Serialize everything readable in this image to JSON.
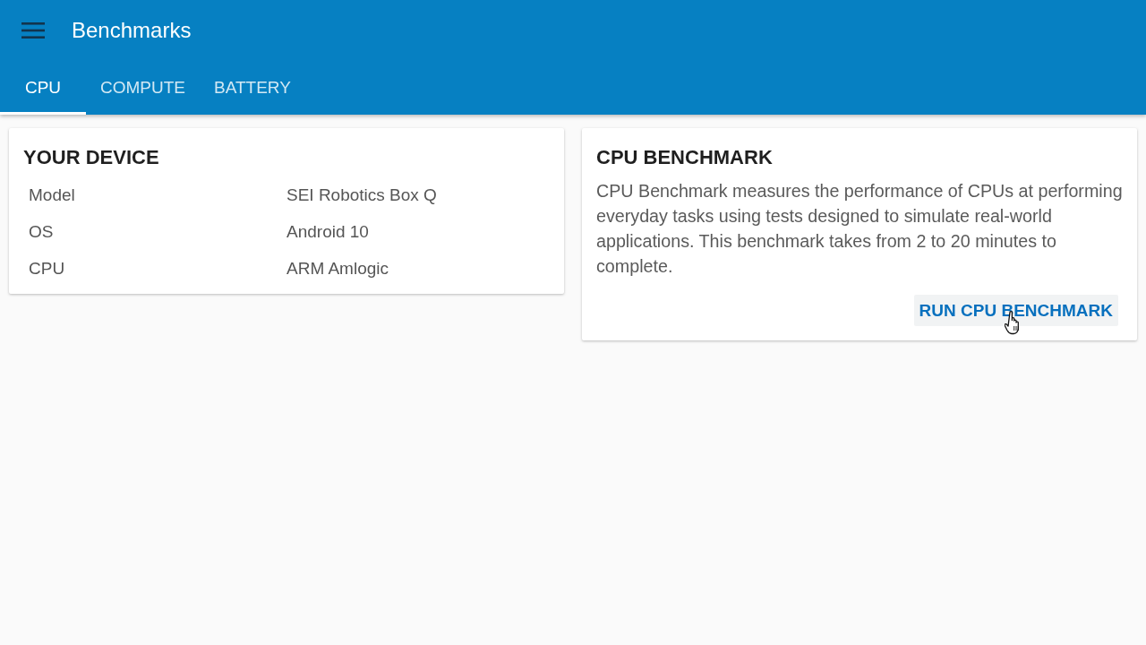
{
  "app_bar": {
    "title": "Benchmarks"
  },
  "tabs": [
    {
      "label": "CPU",
      "selected": true
    },
    {
      "label": "COMPUTE",
      "selected": false
    },
    {
      "label": "BATTERY",
      "selected": false
    }
  ],
  "device_card": {
    "title": "YOUR DEVICE",
    "rows": [
      {
        "label": "Model",
        "value": "SEI Robotics Box Q"
      },
      {
        "label": "OS",
        "value": "Android 10"
      },
      {
        "label": "CPU",
        "value": "ARM Amlogic"
      }
    ]
  },
  "benchmark_card": {
    "title": "CPU BENCHMARK",
    "description": "CPU Benchmark measures the performance of CPUs at performing everyday tasks using tests designed to simulate real-world applications. This benchmark takes from 2 to 20 minutes to complete.",
    "button": {
      "label": "RUN CPU BENCHMARK",
      "focused": true
    }
  }
}
